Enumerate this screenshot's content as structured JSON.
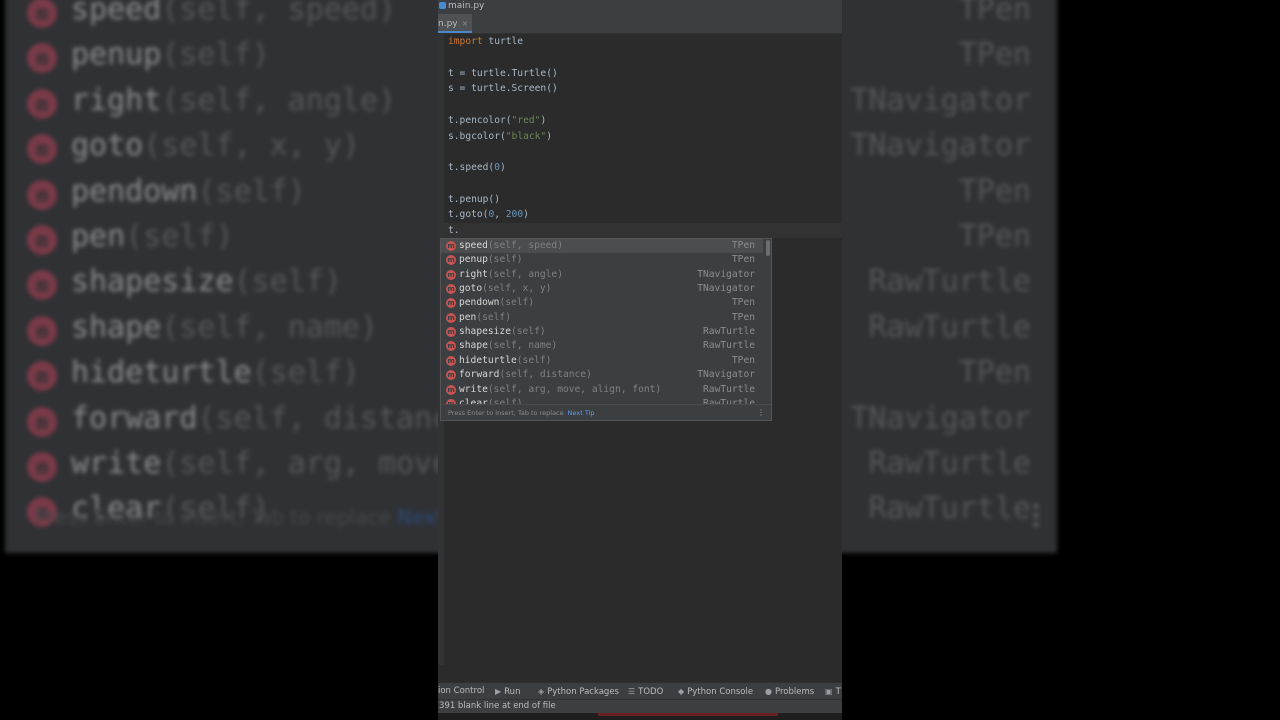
{
  "window": {
    "file_name": "main.py"
  },
  "tab": {
    "label": "n.py",
    "close": "×"
  },
  "code": [
    {
      "parts": [
        {
          "t": "import",
          "c": "kw"
        },
        {
          "t": " turtle",
          "c": ""
        }
      ]
    },
    {
      "parts": []
    },
    {
      "parts": [
        {
          "t": "t = turtle.Turtle()",
          "c": ""
        }
      ]
    },
    {
      "parts": [
        {
          "t": "s = turtle.Screen()",
          "c": ""
        }
      ]
    },
    {
      "parts": []
    },
    {
      "parts": [
        {
          "t": "t.pencolor(",
          "c": ""
        },
        {
          "t": "\"red\"",
          "c": "str"
        },
        {
          "t": ")",
          "c": ""
        }
      ]
    },
    {
      "parts": [
        {
          "t": "s.bgcolor(",
          "c": ""
        },
        {
          "t": "\"black\"",
          "c": "str"
        },
        {
          "t": ")",
          "c": ""
        }
      ]
    },
    {
      "parts": []
    },
    {
      "parts": [
        {
          "t": "t.speed(",
          "c": ""
        },
        {
          "t": "0",
          "c": "num"
        },
        {
          "t": ")",
          "c": ""
        }
      ]
    },
    {
      "parts": []
    },
    {
      "parts": [
        {
          "t": "t.penup()",
          "c": ""
        }
      ]
    },
    {
      "parts": [
        {
          "t": "t.goto(",
          "c": ""
        },
        {
          "t": "0",
          "c": "num"
        },
        {
          "t": ", ",
          "c": ""
        },
        {
          "t": "200",
          "c": "num"
        },
        {
          "t": ")",
          "c": ""
        }
      ]
    },
    {
      "parts": [
        {
          "t": "t.",
          "c": ""
        }
      ]
    }
  ],
  "completion": {
    "marker": "m",
    "items": [
      {
        "name": "speed",
        "args": "(self, speed)",
        "type": "TPen"
      },
      {
        "name": "penup",
        "args": "(self)",
        "type": "TPen"
      },
      {
        "name": "right",
        "args": "(self, angle)",
        "type": "TNavigator"
      },
      {
        "name": "goto",
        "args": "(self, x, y)",
        "type": "TNavigator"
      },
      {
        "name": "pendown",
        "args": "(self)",
        "type": "TPen"
      },
      {
        "name": "pen",
        "args": "(self)",
        "type": "TPen"
      },
      {
        "name": "shapesize",
        "args": "(self)",
        "type": "RawTurtle"
      },
      {
        "name": "shape",
        "args": "(self, name)",
        "type": "RawTurtle"
      },
      {
        "name": "hideturtle",
        "args": "(self)",
        "type": "TPen"
      },
      {
        "name": "forward",
        "args": "(self, distance)",
        "type": "TNavigator"
      },
      {
        "name": "write",
        "args": "(self, arg, move, align, font)",
        "type": "RawTurtle"
      },
      {
        "name": "clear",
        "args": "(self)",
        "type": "RawTurtle"
      }
    ],
    "footer_hint": "Press Enter to insert, Tab to replace",
    "footer_link": "Next Tip",
    "more_icon": "⋮"
  },
  "background_zoom": {
    "items": [
      {
        "name": "speed",
        "args": "(self, speed)",
        "type": "TPen"
      },
      {
        "name": "penup",
        "args": "(self)",
        "type": "TPen"
      },
      {
        "name": "right",
        "args": "(self, angle)",
        "type": "TNavigator"
      },
      {
        "name": "goto",
        "args": "(self, x, y)",
        "type": "TNavigator"
      },
      {
        "name": "pendown",
        "args": "(self)",
        "type": "TPen"
      },
      {
        "name": "pen",
        "args": "(self)",
        "type": "TPen"
      },
      {
        "name": "shapesize",
        "args": "(self)",
        "type": "RawTurtle"
      },
      {
        "name": "shape",
        "args": "(self, name)",
        "type": "RawTurtle"
      },
      {
        "name": "hideturtle",
        "args": "(self)",
        "type": "TPen"
      },
      {
        "name": "forward",
        "args": "(self, distance)",
        "type": "TNavigator"
      },
      {
        "name": "write",
        "args": "(self, arg, move",
        "type": "RawTurtle"
      },
      {
        "name": "clear",
        "args": "(self)",
        "type": "RawTurtle"
      }
    ],
    "hint": "Press Enter to insert, Tab to replace",
    "link": "Next"
  },
  "toolwindows": [
    {
      "label": "ion Control",
      "icon": ""
    },
    {
      "label": "Run",
      "icon": "▶"
    },
    {
      "label": "Python Packages",
      "icon": "◈"
    },
    {
      "label": "TODO",
      "icon": "☰"
    },
    {
      "label": "Python Console",
      "icon": "◆"
    },
    {
      "label": "Problems",
      "icon": "●"
    },
    {
      "label": "T",
      "icon": "▣"
    }
  ],
  "status": {
    "message": "391 blank line at end of file"
  }
}
